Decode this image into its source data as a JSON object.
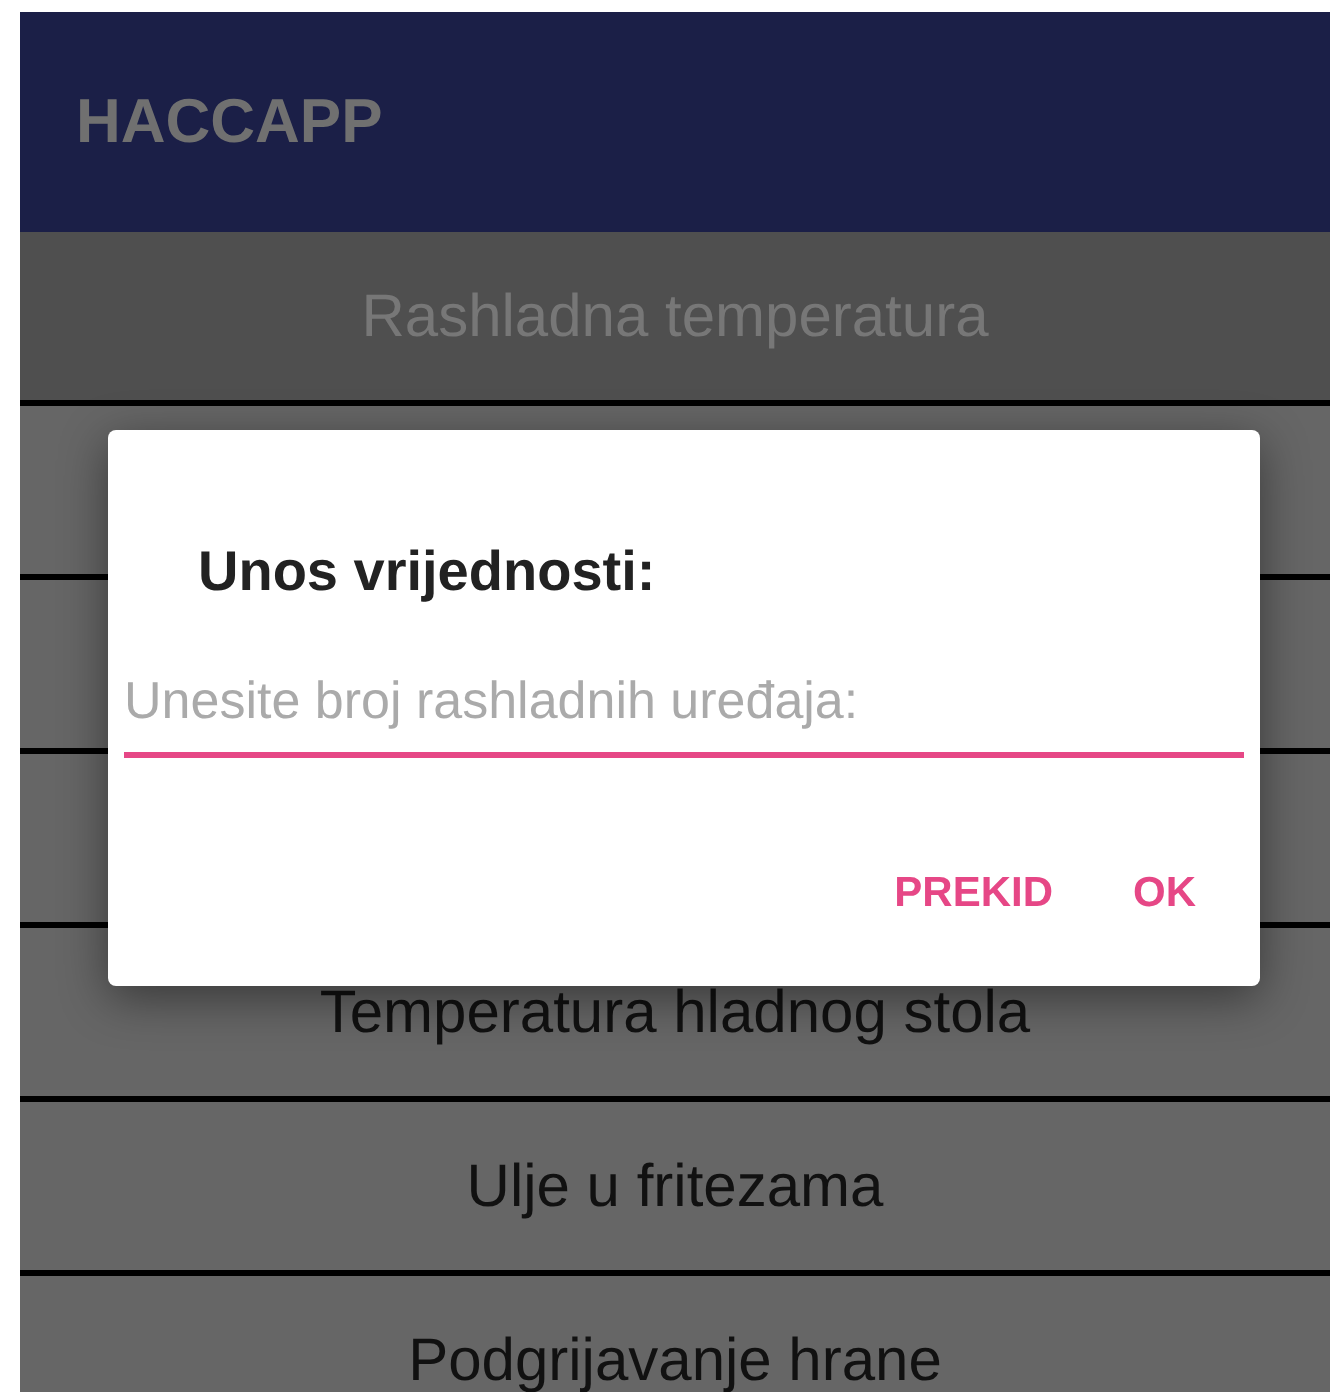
{
  "app_bar": {
    "title": "HACCAPP"
  },
  "list": [
    {
      "kind": "header",
      "label": "Rashladna temperatura"
    },
    {
      "kind": "item",
      "label": "Temperatura hladnog stola"
    },
    {
      "kind": "item",
      "label": "Ulje u fritezama"
    },
    {
      "kind": "item",
      "label": "Podgrijavanje hrane"
    }
  ],
  "dialog": {
    "title": "Unos vrijednosti:",
    "field": {
      "placeholder": "Unesite broj rashladnih uređaja:"
    },
    "buttons": [
      "PREKID",
      "OK"
    ]
  }
}
